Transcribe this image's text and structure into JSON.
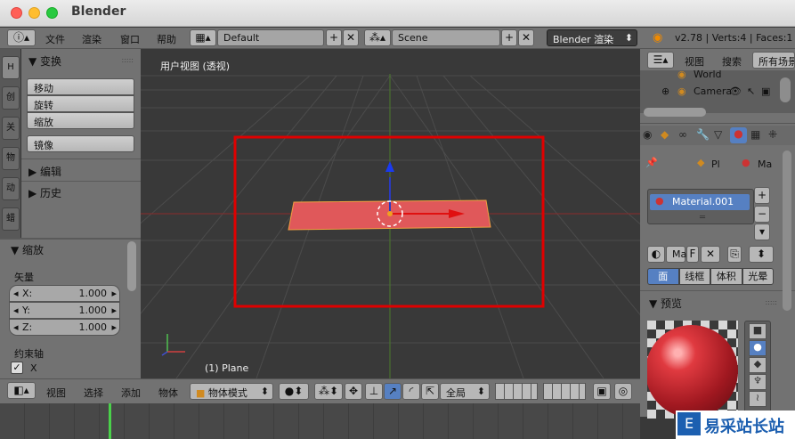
{
  "window": {
    "title": "Blender"
  },
  "header": {
    "menu": [
      "文件",
      "渲染",
      "窗口",
      "帮助"
    ],
    "layout": "Default",
    "scene": "Scene",
    "engine": "Blender 渲染",
    "stats": "v2.78 | Verts:4 | Faces:1"
  },
  "tabs": [
    "H",
    "创",
    "关",
    "物",
    "动",
    "蜡"
  ],
  "tool": {
    "transform": "变换",
    "move": "移动",
    "rotate": "旋转",
    "scale": "缩放",
    "mirror": "镜像",
    "edit": "编辑",
    "history": "历史"
  },
  "op": {
    "title": "缩放",
    "vector": "矢量",
    "x": "X:",
    "xv": "1.000",
    "y": "Y:",
    "yv": "1.000",
    "z": "Z:",
    "zv": "1.000",
    "constraint": "约束轴",
    "cx": "X"
  },
  "viewport": {
    "label": "用户视图 (透视)",
    "object": "(1) Plane"
  },
  "vpbar": {
    "view": "视图",
    "select": "选择",
    "add": "添加",
    "object": "物体",
    "mode": "物体模式",
    "pivot": "全局"
  },
  "outliner": {
    "view": "视图",
    "search": "搜索",
    "filter": "所有场景",
    "world": "World",
    "camera": "Camera"
  },
  "props": {
    "pl": "Pl",
    "ma": "Ma",
    "material": "Material.001",
    "maf": "Ma",
    "f": "F",
    "tabs": [
      "面",
      "线框",
      "体积",
      "光晕"
    ],
    "preview": "预览"
  },
  "watermark": "易采站长站",
  "colors": {
    "accent": "#5680c2",
    "select_box": "#e00000",
    "plane": "#e0585a"
  }
}
